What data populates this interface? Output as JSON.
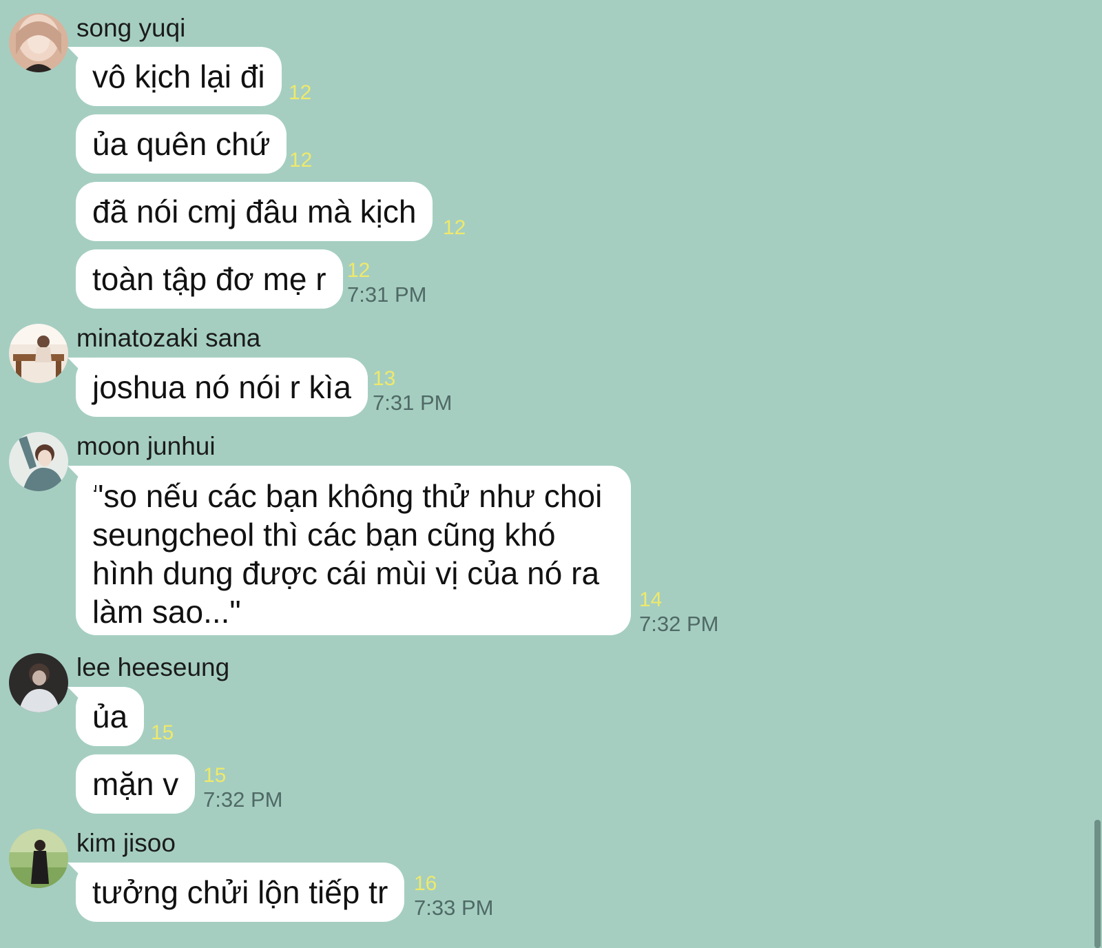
{
  "colors": {
    "background": "#a5cec1",
    "bubble": "#ffffff",
    "read_count": "#efe96a",
    "timestamp": "#4f6964"
  },
  "groups": [
    {
      "sender": "song yuqi",
      "messages": [
        {
          "text": "vô kịch lại đi",
          "count": "12"
        },
        {
          "text": "ủa quên chứ",
          "count": "12"
        },
        {
          "text": "đã nói cmj đâu mà kịch",
          "count": "12"
        },
        {
          "text": "toàn tập đơ mẹ r",
          "count": "12",
          "time": "7:31 PM"
        }
      ]
    },
    {
      "sender": "minatozaki sana",
      "messages": [
        {
          "text": "joshua nó nói r kìa",
          "count": "13",
          "time": "7:31 PM"
        }
      ]
    },
    {
      "sender": "moon junhui",
      "messages": [
        {
          "text": "\"so nếu các bạn không thử như choi seungcheol thì các bạn cũng khó hình dung được cái mùi vị của nó ra làm sao...\"",
          "count": "14",
          "time": "7:32 PM"
        }
      ]
    },
    {
      "sender": "lee heeseung",
      "messages": [
        {
          "text": "ủa",
          "count": "15"
        },
        {
          "text": "mặn v",
          "count": "15",
          "time": "7:32 PM"
        }
      ]
    },
    {
      "sender": "kim jisoo",
      "messages": [
        {
          "text": "tưởng chửi lộn tiếp tr",
          "count": "16",
          "time": "7:33 PM"
        }
      ]
    }
  ]
}
